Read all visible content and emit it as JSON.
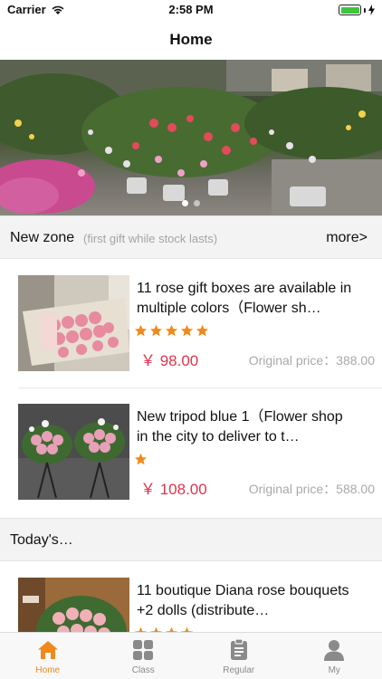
{
  "status": {
    "carrier": "Carrier",
    "time": "2:58 PM",
    "battery_level": 1.0
  },
  "nav": {
    "title": "Home"
  },
  "banner": {
    "slides": 2,
    "active_slide": 1
  },
  "new_zone": {
    "label": "New zone",
    "sublabel": "(first gift while stock lasts)",
    "more": "more>"
  },
  "products": [
    {
      "name": "11 rose gift boxes are available in multiple colors（Flower sh…",
      "rating": 5,
      "price": "￥ 98.00",
      "original_price": "Original price：388.00"
    },
    {
      "name": "New tripod blue 1（Flower shop in the city to deliver to t…",
      "rating": 1,
      "price": "￥ 108.00",
      "original_price": "Original price：588.00"
    }
  ],
  "today": {
    "label": "Today's…"
  },
  "today_products": [
    {
      "name": "11 boutique Diana rose bouquets +2 dolls (distribute…",
      "rating": 4
    }
  ],
  "tabs": [
    {
      "label": "Home",
      "icon": "home-icon",
      "active": true
    },
    {
      "label": "Class",
      "icon": "grid-icon",
      "active": false
    },
    {
      "label": "Regular",
      "icon": "clipboard-icon",
      "active": false
    },
    {
      "label": "My",
      "icon": "person-icon",
      "active": false
    }
  ],
  "colors": {
    "accent": "#f08a1c",
    "price": "#e0344b",
    "star": "#f08a1c",
    "battery": "#3ec53e"
  }
}
